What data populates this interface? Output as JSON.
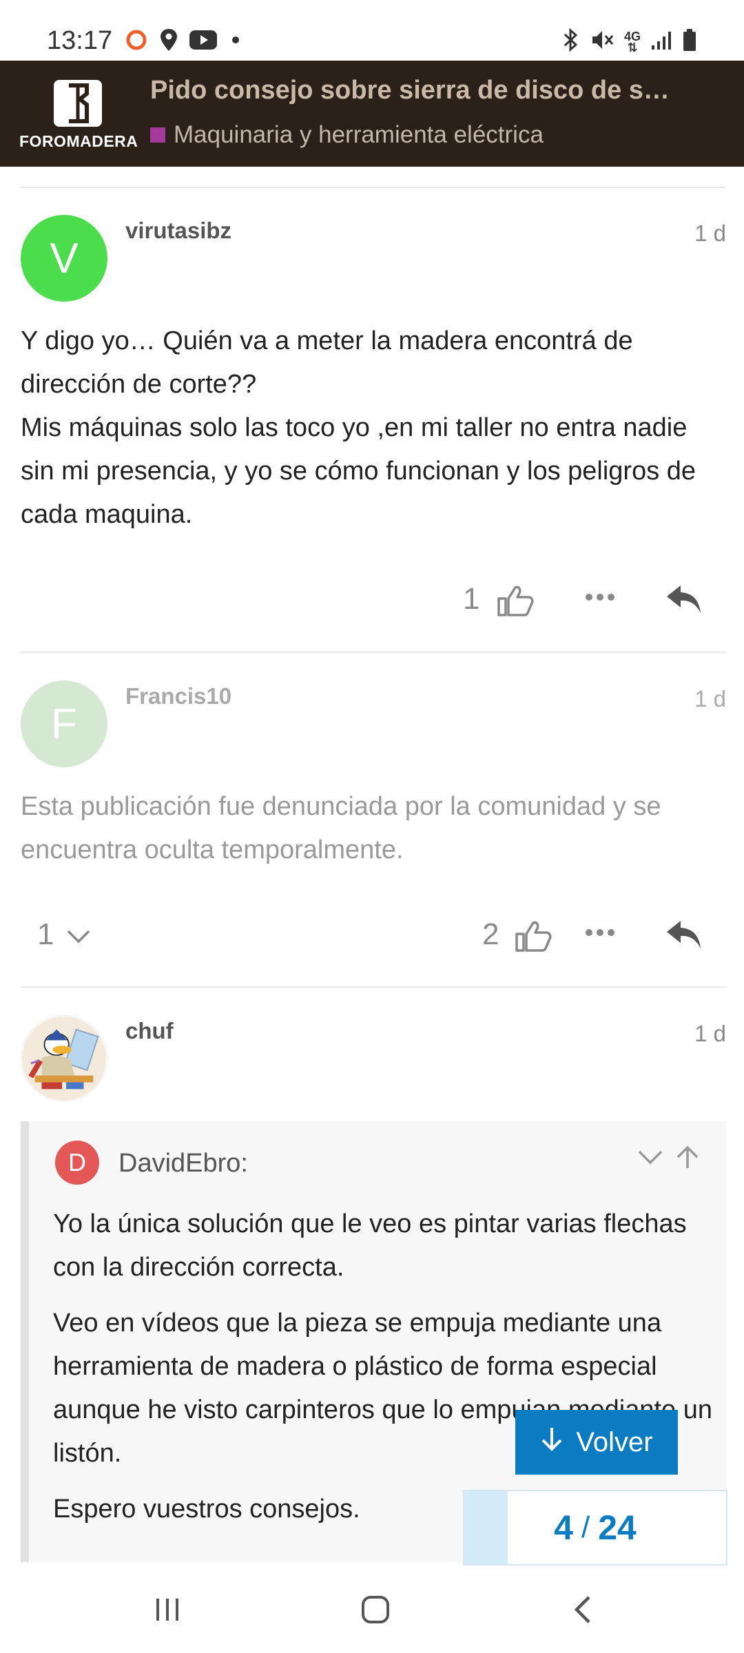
{
  "status_bar": {
    "time": "13:17",
    "left_icons": [
      "recording-ring-icon",
      "location-icon",
      "youtube-icon",
      "dot-icon"
    ],
    "right_icons": [
      "bluetooth-icon",
      "mute-icon",
      "4g-icon",
      "signal-icon",
      "battery-icon"
    ],
    "network_label": "4G"
  },
  "header": {
    "logo_text": "FOROMADERA",
    "topic_title": "Pido consejo sobre sierra de disco de s…",
    "category": "Maquinaria y herramienta eléctrica",
    "category_color": "#a43b9c",
    "background": "#2c2118"
  },
  "posts": [
    {
      "avatar_letter": "V",
      "avatar_color": "#4cdd4c",
      "username": "virutasibz",
      "date": "1 d",
      "body": [
        "Y digo yo… Quién va a meter la madera encontrá de dirección de corte??",
        "Mis máquinas solo las toco yo ,en mi taller no entra nadie sin mi presencia, y yo se cómo funcionan y los peligros de cada maquina."
      ],
      "likes": "1"
    },
    {
      "avatar_letter": "F",
      "avatar_color": "#d5e8d1",
      "username": "Francis10",
      "date": "1 d",
      "body": [
        "Esta publicación fue denunciada por la comunidad y se encuentra oculta temporalmente."
      ],
      "replies": "1",
      "likes": "2"
    },
    {
      "username": "chuf",
      "date": "1 d",
      "quote": {
        "avatar_letter": "D",
        "username": "DavidEbro:",
        "paragraphs": [
          "Yo la única solución que le veo es pintar varias flechas con la dirección correcta.",
          "Veo en vídeos que la pieza se empuja mediante una herramienta de madera o plástico de forma especial aunque he visto carpinteros que lo empujan mediante un listón.",
          "Espero vuestros consejos."
        ]
      }
    }
  ],
  "floating": {
    "volver_label": "Volver",
    "progress_current": "4",
    "progress_separator": "/",
    "progress_total": "24",
    "progress_fraction": 0.167,
    "accent": "#0b7bc2"
  },
  "navbar": {
    "items": [
      "recent-apps-icon",
      "home-icon",
      "back-icon"
    ]
  }
}
